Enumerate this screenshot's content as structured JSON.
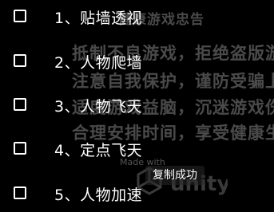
{
  "background_notice": {
    "title": "健康游戏忠告",
    "lines": [
      "抵制不良游戏，拒绝盗版游戏",
      "注意自我保护，谨防受骗上当",
      "适度游戏益脑，沉迷游戏伤身",
      "合理安排时间，享受健康生活"
    ],
    "made_with": "Made with",
    "engine_logo": "unity"
  },
  "menu": {
    "items": [
      {
        "label": "1、贴墙透视",
        "checked": false
      },
      {
        "label": "2、人物爬墙",
        "checked": false
      },
      {
        "label": "3、人物飞天",
        "checked": false
      },
      {
        "label": "4、定点飞天",
        "checked": false
      },
      {
        "label": "5、人物加速",
        "checked": false
      }
    ]
  },
  "toast": {
    "message": "复制成功"
  }
}
